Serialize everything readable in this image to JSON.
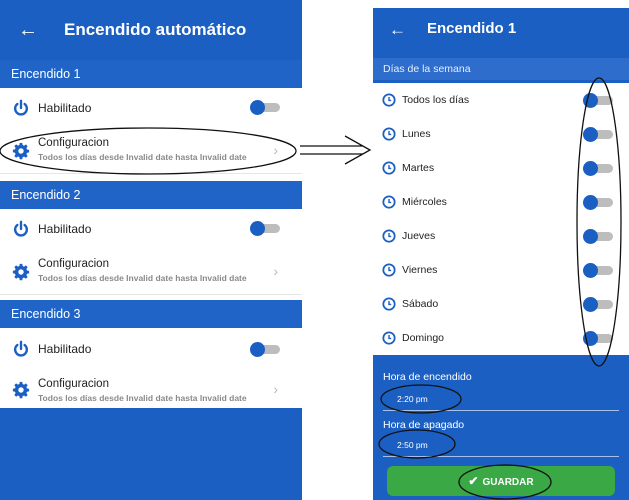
{
  "left_screen": {
    "title": "Encendido automático",
    "sections": [
      {
        "header": "Encendido 1",
        "enabled_label": "Habilitado",
        "config_title": "Configuracion",
        "config_subtitle": "Todos los días desde Invalid date hasta Invalid date"
      },
      {
        "header": "Encendido 2",
        "enabled_label": "Habilitado",
        "config_title": "Configuracion",
        "config_subtitle": "Todos los días desde Invalid date hasta Invalid date"
      },
      {
        "header": "Encendido 3",
        "enabled_label": "Habilitado",
        "config_title": "Configuracion",
        "config_subtitle": "Todos los días desde Invalid date hasta Invalid date"
      }
    ]
  },
  "right_screen": {
    "title": "Encendido 1",
    "days_header": "Días de la semana",
    "days": [
      {
        "label": "Todos los días"
      },
      {
        "label": "Lunes"
      },
      {
        "label": "Martes"
      },
      {
        "label": "Miércoles"
      },
      {
        "label": "Jueves"
      },
      {
        "label": "Viernes"
      },
      {
        "label": "Sábado"
      },
      {
        "label": "Domingo"
      }
    ],
    "on_time_label": "Hora de encendido",
    "on_time_value": "2:20 pm",
    "off_time_label": "Hora de apagado",
    "off_time_value": "2:50 pm",
    "save_label": "GUARDAR"
  },
  "colors": {
    "primary": "#1b5fc3",
    "section": "#2164c8",
    "save": "#39a845",
    "toggle_track": "#bdbdbd"
  },
  "icons": [
    "back-arrow-icon",
    "power-icon",
    "gear-icon",
    "chevron-right-icon",
    "clock-icon",
    "check-icon"
  ]
}
